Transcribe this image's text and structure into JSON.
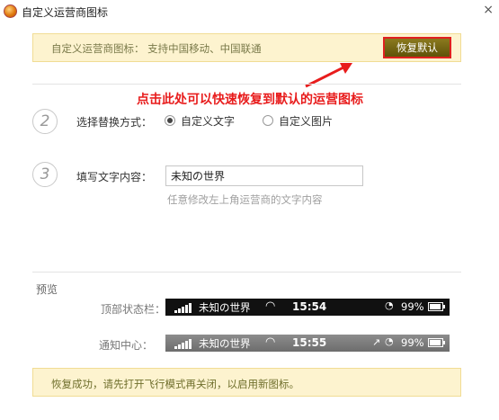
{
  "window": {
    "title": "自定义运营商图标",
    "close": "×"
  },
  "notice": {
    "text": "自定义运营商图标： 支持中国移动、中国联通",
    "restore_button": "恢复默认"
  },
  "annotation": {
    "text": "点击此处可以快速恢复到默认的运营图标",
    "color": "#e81c1c"
  },
  "step2": {
    "number": "2",
    "label": "选择替换方式：",
    "options": [
      {
        "label": "自定义文字",
        "selected": true
      },
      {
        "label": "自定义图片",
        "selected": false
      }
    ]
  },
  "step3": {
    "number": "3",
    "label": "填写文字内容：",
    "input_value": "未知の世界",
    "hint": "任意修改左上角运营商的文字内容"
  },
  "preview": {
    "title": "预览",
    "statusbar_label": "顶部状态栏：",
    "notification_label": "通知中心：",
    "status_dark": {
      "carrier": "未知の世界",
      "time": "15:54",
      "battery": "99%",
      "icons": [
        "signal-icon",
        "wifi-icon",
        "lock-rotation-icon",
        "battery-icon"
      ]
    },
    "status_light": {
      "carrier": "未知の世界",
      "time": "15:55",
      "battery": "99%",
      "icons": [
        "signal-icon",
        "wifi-icon",
        "location-icon",
        "lock-rotation-icon",
        "battery-icon"
      ]
    }
  },
  "success": {
    "text": "恢复成功，请先打开飞行模式再关闭，以启用新图标。"
  },
  "colors": {
    "notice_bg": "#fdf3cf",
    "button_bg": "#6f6212",
    "highlight_border": "#e02020"
  }
}
